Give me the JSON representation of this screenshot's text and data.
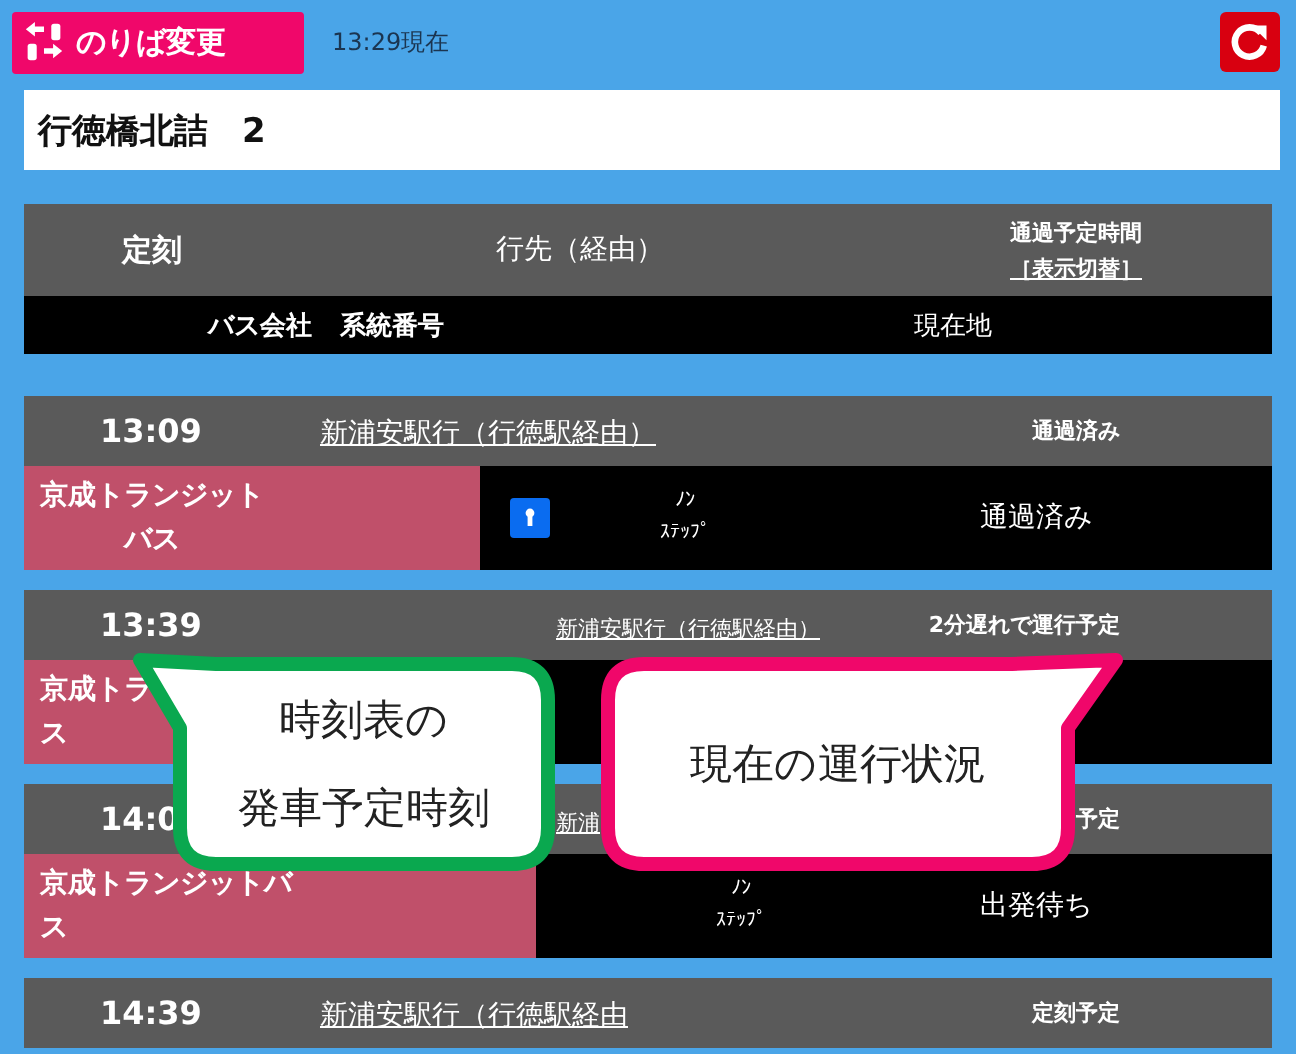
{
  "header": {
    "platform_change_button": "のりば変更",
    "timestamp": "13:29現在"
  },
  "stop": {
    "name": "行徳橋北詰　2"
  },
  "table_header": {
    "scheduled": "定刻",
    "destination": "行先（経由）",
    "pass_time": "通過予定時間",
    "toggle_link": "［表示切替］",
    "company": "バス会社",
    "route_number": "系統番号",
    "location": "現在地"
  },
  "departures": [
    {
      "overlaid": false,
      "time": "13:09",
      "destination": "新浦安駅行（行徳駅経由）",
      "status": "通過済み",
      "company_lines": [
        "京成トランジット",
        "バス"
      ],
      "accessible_icon": true,
      "vehicle_lines": [
        "ﾉﾝ",
        "ｽﾃｯﾌﾟ"
      ],
      "location": "通過済み"
    },
    {
      "overlaid": true,
      "time": "13:39",
      "destination": "新浦安駅行（行徳駅経由）",
      "status": "2分遅れで運行予定",
      "company_lines": [
        "京成トラ",
        "ス"
      ],
      "accessible_icon": false
    },
    {
      "overlaid": true,
      "time": "14:0",
      "destination": "新浦",
      "status": "予定",
      "company_lines": [
        "京成トランジットバ",
        "ス"
      ],
      "accessible_icon": false,
      "vehicle_lines": [
        "ﾉﾝ",
        "ｽﾃｯﾌﾟ"
      ],
      "location": "出発待ち"
    },
    {
      "overlaid": false,
      "time": "14:39",
      "destination": "新浦安駅行（行徳駅経由",
      "status": "定刻予定"
    }
  ],
  "callouts": [
    {
      "color": "#0aa84f",
      "text_lines": [
        "時刻表の",
        "発車予定時刻"
      ]
    },
    {
      "color": "#f0076a",
      "text_lines": [
        "現在の運行状況"
      ]
    }
  ]
}
